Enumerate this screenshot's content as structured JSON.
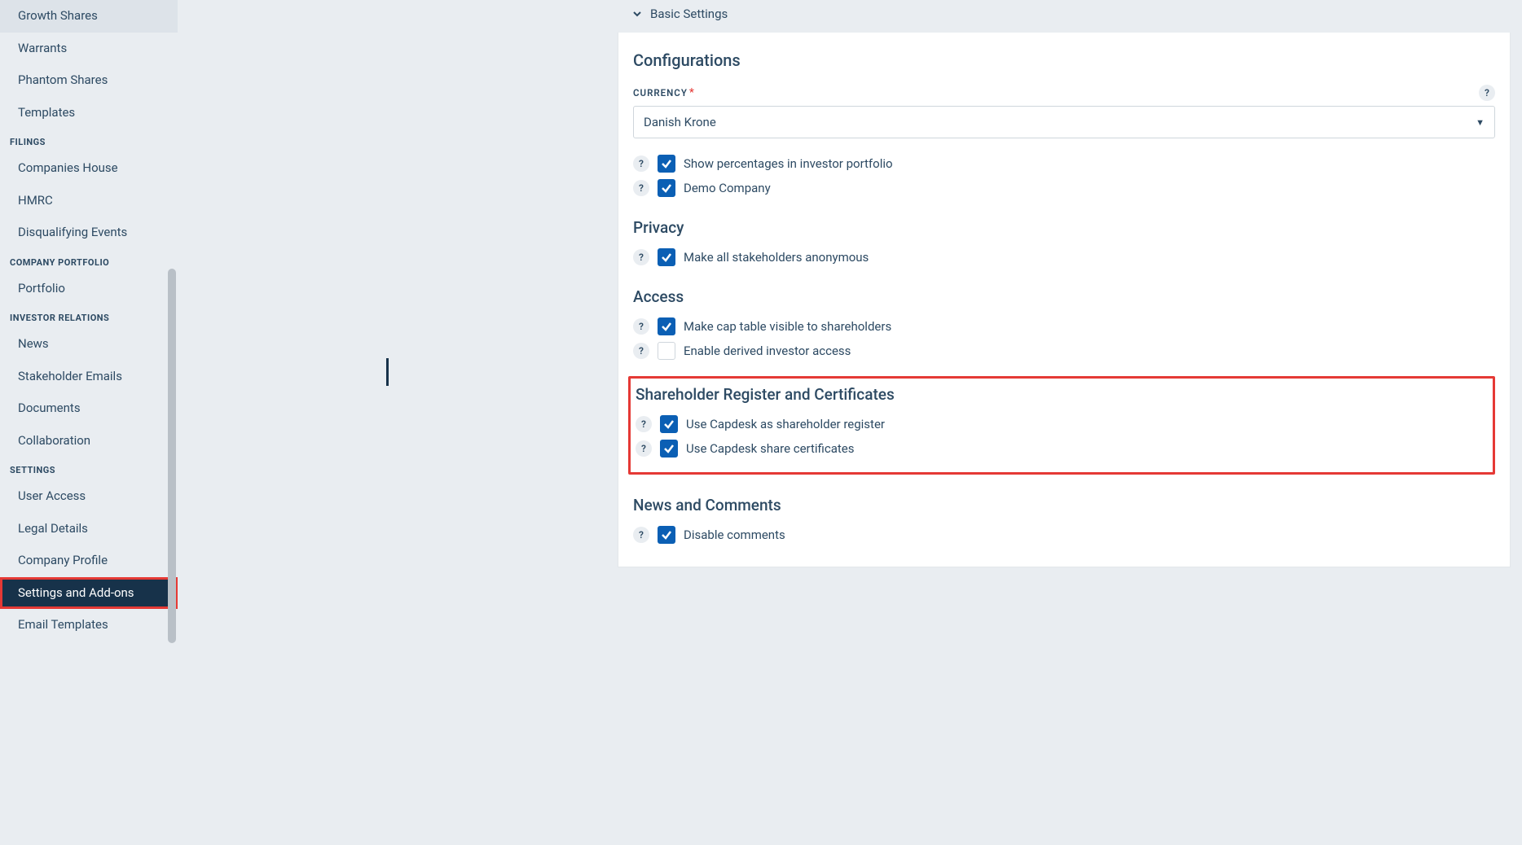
{
  "sidebar": {
    "top_items": [
      "Growth Shares",
      "Warrants",
      "Phantom Shares",
      "Templates"
    ],
    "sections": [
      {
        "heading": "FILINGS",
        "items": [
          "Companies House",
          "HMRC",
          "Disqualifying Events"
        ]
      },
      {
        "heading": "COMPANY PORTFOLIO",
        "items": [
          "Portfolio"
        ]
      },
      {
        "heading": "INVESTOR RELATIONS",
        "items": [
          "News",
          "Stakeholder Emails",
          "Documents",
          "Collaboration"
        ]
      },
      {
        "heading": "SETTINGS",
        "items": [
          "User Access",
          "Legal Details",
          "Company Profile",
          "Settings and Add-ons",
          "Email Templates"
        ]
      }
    ],
    "active_item": "Settings and Add-ons"
  },
  "panel": {
    "header": "Basic Settings",
    "configurations": {
      "title": "Configurations",
      "currency_label": "CURRENCY",
      "currency_value": "Danish Krone",
      "options": [
        {
          "label": "Show percentages in investor portfolio",
          "checked": true
        },
        {
          "label": "Demo Company",
          "checked": true
        }
      ]
    },
    "privacy": {
      "title": "Privacy",
      "options": [
        {
          "label": "Make all stakeholders anonymous",
          "checked": true
        }
      ]
    },
    "access": {
      "title": "Access",
      "options": [
        {
          "label": "Make cap table visible to shareholders",
          "checked": true
        },
        {
          "label": "Enable derived investor access",
          "checked": false
        }
      ]
    },
    "shareholder": {
      "title": "Shareholder Register and Certificates",
      "options": [
        {
          "label": "Use Capdesk as shareholder register",
          "checked": true
        },
        {
          "label": "Use Capdesk share certificates",
          "checked": true
        }
      ]
    },
    "news": {
      "title": "News and Comments",
      "options": [
        {
          "label": "Disable comments",
          "checked": true
        }
      ]
    }
  }
}
